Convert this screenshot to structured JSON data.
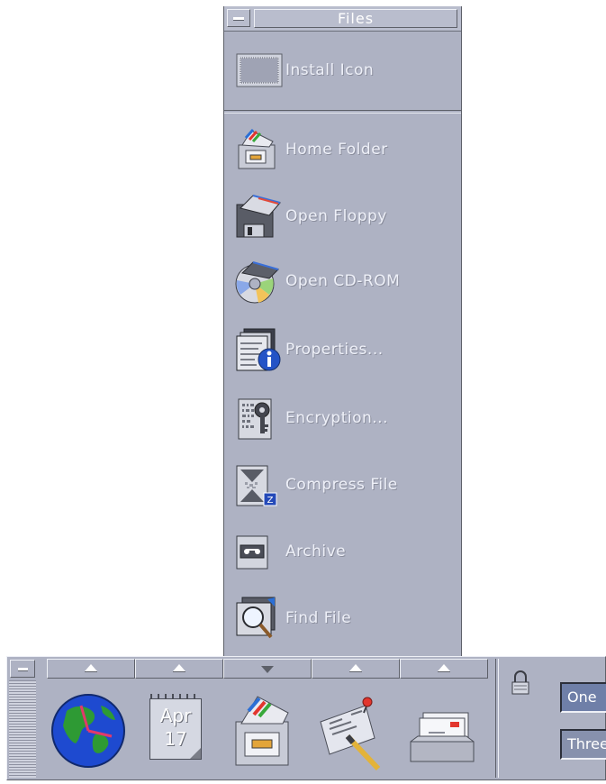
{
  "subpanel": {
    "title": "Files",
    "install_label": "Install Icon",
    "items": [
      {
        "label": "Home Folder",
        "icon": "home-folder-icon"
      },
      {
        "label": "Open Floppy",
        "icon": "floppy-icon"
      },
      {
        "label": "Open CD-ROM",
        "icon": "cdrom-icon"
      },
      {
        "label": "Properties...",
        "icon": "properties-icon"
      },
      {
        "label": "Encryption...",
        "icon": "encryption-icon"
      },
      {
        "label": "Compress File",
        "icon": "compress-icon"
      },
      {
        "label": "Archive",
        "icon": "archive-icon"
      },
      {
        "label": "Find File",
        "icon": "find-file-icon"
      }
    ]
  },
  "frontpanel": {
    "calendar": {
      "month": "Apr",
      "day": "17"
    },
    "arrows": [
      "up",
      "up",
      "down",
      "up",
      "up"
    ],
    "workspaces": [
      "One",
      "Three"
    ]
  },
  "colors": {
    "panel": "#aeb2c3",
    "workspace_active": "#6f7fa8"
  }
}
